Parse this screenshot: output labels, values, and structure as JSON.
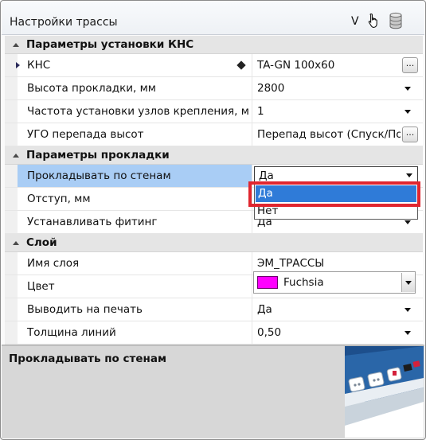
{
  "window": {
    "title": "Настройки трассы",
    "toolbar_v": "V",
    "icons": [
      "hand-pointer-icon",
      "database-icon"
    ]
  },
  "categories": [
    {
      "name": "Параметры установки КНС",
      "rows": [
        {
          "name": "КНС",
          "value": "TA-GN 100x60"
        },
        {
          "name": "Высота прокладки, мм",
          "value": "2800"
        },
        {
          "name": "Частота установки узлов крепления, м",
          "value": "1"
        },
        {
          "name": "УГО перепада высот",
          "value": "Перепад высот (Спуск/Подъем)"
        }
      ]
    },
    {
      "name": "Параметры прокладки",
      "rows": [
        {
          "name": "Прокладывать по стенам",
          "value": "Да"
        },
        {
          "name": "Отступ, мм",
          "value": ""
        },
        {
          "name": "Устанавливать фитинг",
          "value": "Да"
        }
      ]
    },
    {
      "name": "Слой",
      "rows": [
        {
          "name": "Имя слоя",
          "value": "ЭМ_ТРАССЫ"
        },
        {
          "name": "Цвет",
          "value": "Fuchsia"
        },
        {
          "name": "Выводить на печать",
          "value": "Да"
        },
        {
          "name": "Толщина линий",
          "value": "0,50"
        }
      ]
    }
  ],
  "ellipsis_label": "...",
  "dropdown": {
    "options": [
      "Да",
      "Нет"
    ],
    "selected": "Да"
  },
  "description": {
    "title": "Прокладывать по стенам"
  },
  "colors": {
    "selection": "#a9cdf5",
    "dropdown_selected": "#2f7bd8",
    "highlight_border": "#e0262f",
    "swatch": "#ff00ff"
  }
}
